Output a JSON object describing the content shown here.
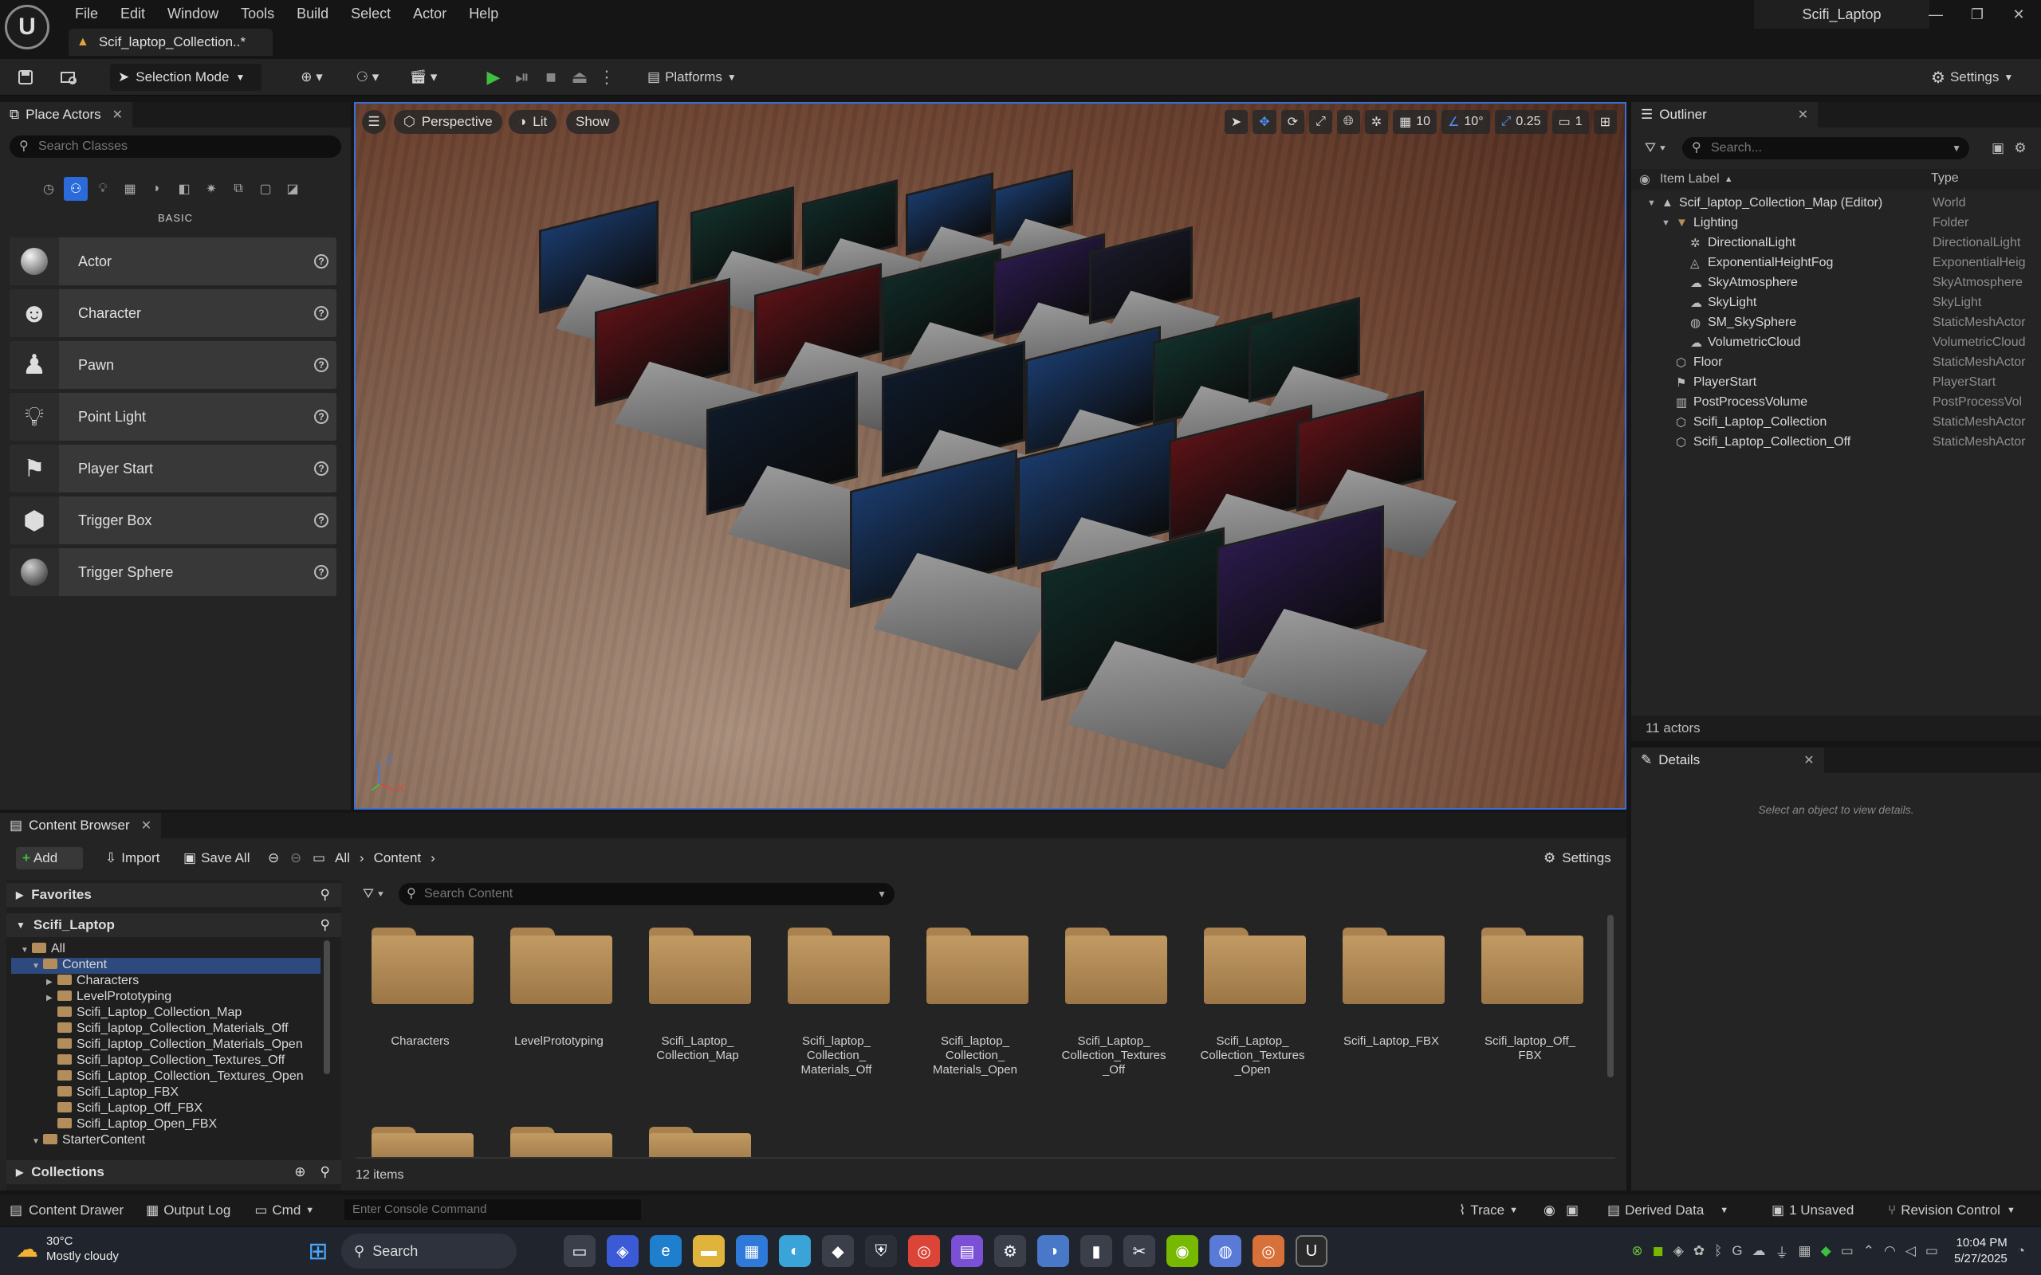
{
  "app": {
    "menu": [
      "File",
      "Edit",
      "Window",
      "Tools",
      "Build",
      "Select",
      "Actor",
      "Help"
    ],
    "doc_tab": "Scif_laptop_Collection..*",
    "project": "Scifi_Laptop"
  },
  "toolbar": {
    "selection_mode": "Selection Mode",
    "platforms": "Platforms",
    "settings": "Settings"
  },
  "place_actors": {
    "tab": "Place Actors",
    "search_placeholder": "Search Classes",
    "category": "BASIC",
    "items": [
      "Actor",
      "Character",
      "Pawn",
      "Point Light",
      "Player Start",
      "Trigger Box",
      "Trigger Sphere"
    ]
  },
  "viewport": {
    "perspective": "Perspective",
    "lit": "Lit",
    "show": "Show",
    "grid_snap": "10",
    "rot_snap": "10°",
    "scale_snap": "0.25",
    "camera_speed": "1",
    "axis_z": "Z",
    "axis_x": "X"
  },
  "outliner": {
    "tab": "Outliner",
    "search_placeholder": "Search...",
    "col_label": "Item Label",
    "col_type": "Type",
    "rows": [
      {
        "label": "Scif_laptop_Collection_Map (Editor)",
        "type": "World"
      },
      {
        "label": "Lighting",
        "type": "Folder"
      },
      {
        "label": "DirectionalLight",
        "type": "DirectionalLight"
      },
      {
        "label": "ExponentialHeightFog",
        "type": "ExponentialHeig"
      },
      {
        "label": "SkyAtmosphere",
        "type": "SkyAtmosphere"
      },
      {
        "label": "SkyLight",
        "type": "SkyLight"
      },
      {
        "label": "SM_SkySphere",
        "type": "StaticMeshActor"
      },
      {
        "label": "VolumetricCloud",
        "type": "VolumetricCloud"
      },
      {
        "label": "Floor",
        "type": "StaticMeshActor"
      },
      {
        "label": "PlayerStart",
        "type": "PlayerStart"
      },
      {
        "label": "PostProcessVolume",
        "type": "PostProcessVol"
      },
      {
        "label": "Scifi_Laptop_Collection",
        "type": "StaticMeshActor"
      },
      {
        "label": "Scifi_Laptop_Collection_Off",
        "type": "StaticMeshActor"
      }
    ],
    "count": "11 actors"
  },
  "details": {
    "tab": "Details",
    "empty": "Select an object to view details."
  },
  "content_browser": {
    "tab": "Content Browser",
    "add": "Add",
    "import": "Import",
    "save_all": "Save All",
    "crumb_all": "All",
    "crumb_content": "Content",
    "settings": "Settings",
    "favorites": "Favorites",
    "project": "Scifi_Laptop",
    "search_placeholder": "Search Content",
    "collections": "Collections",
    "tree": [
      "All",
      "Content",
      "Characters",
      "LevelPrototyping",
      "Scifi_Laptop_Collection_Map",
      "Scifi_laptop_Collection_Materials_Off",
      "Scifi_laptop_Collection_Materials_Open",
      "Scifi_laptop_Collection_Textures_Off",
      "Scifi_Laptop_Collection_Textures_Open",
      "Scifi_Laptop_FBX",
      "Scifi_Laptop_Off_FBX",
      "Scifi_Laptop_Open_FBX",
      "StarterContent"
    ],
    "assets": [
      "Characters",
      "LevelPrototyping",
      "Scifi_Laptop_\nCollection_Map",
      "Scifi_laptop_\nCollection_\nMaterials_Off",
      "Scifi_laptop_\nCollection_\nMaterials_Open",
      "Scifi_Laptop_\nCollection_Textures\n_Off",
      "Scifi_Laptop_\nCollection_Textures\n_Open",
      "Scifi_Laptop_FBX",
      "Scifi_laptop_Off_\nFBX"
    ],
    "count": "12 items"
  },
  "statusbar": {
    "content_drawer": "Content Drawer",
    "output_log": "Output Log",
    "cmd": "Cmd",
    "console_placeholder": "Enter Console Command",
    "trace": "Trace",
    "derived_data": "Derived Data",
    "unsaved": "1 Unsaved",
    "revision_control": "Revision Control"
  },
  "taskbar": {
    "weather_temp": "30°C",
    "weather_desc": "Mostly cloudy",
    "search": "Search",
    "time": "10:04 PM",
    "date": "5/27/2025"
  },
  "colors": {
    "accent": "#2a6ad9",
    "play": "#3fbf3f",
    "folder": "#b48e5a"
  }
}
